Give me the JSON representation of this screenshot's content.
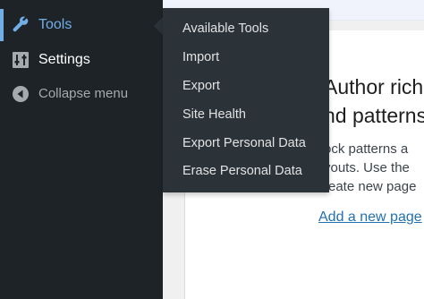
{
  "sidebar": {
    "items": [
      {
        "label": "Tools",
        "icon": "wrench-icon",
        "current": true
      },
      {
        "label": "Settings",
        "icon": "settings-sliders-icon"
      },
      {
        "label": "Collapse menu",
        "icon": "collapse-arrow-icon"
      }
    ]
  },
  "flyout": {
    "items": [
      {
        "label": "Available Tools"
      },
      {
        "label": "Import"
      },
      {
        "label": "Export"
      },
      {
        "label": "Site Health"
      },
      {
        "label": "Export Personal Data"
      },
      {
        "label": "Erase Personal Data"
      }
    ]
  },
  "content": {
    "heading_line1": "Author rich c",
    "heading_line2": "nd patterns",
    "text_line1": "ock patterns a",
    "text_line2": "youts. Use the",
    "text_line3": "reate new page",
    "link": "Add a new page"
  },
  "colors": {
    "sidebar_bg": "#1d2327",
    "flyout_bg": "#2c3338",
    "accent": "#72aee6",
    "link": "#2271b1"
  }
}
